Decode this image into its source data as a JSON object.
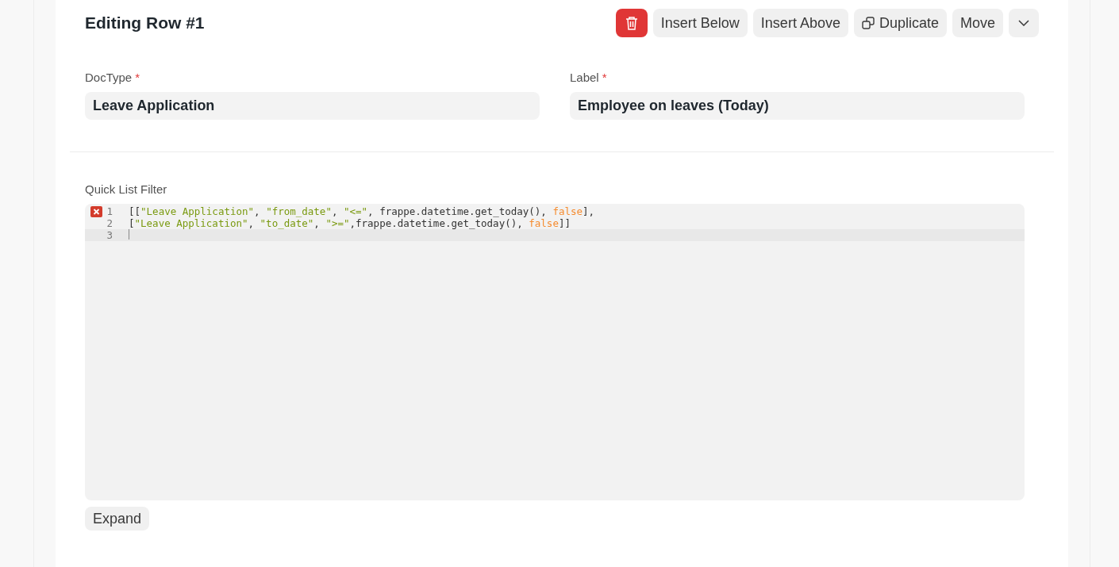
{
  "header": {
    "title": "Editing Row #1"
  },
  "actions": [
    {
      "kind": "delete"
    },
    {
      "kind": "text",
      "label": "Insert Below"
    },
    {
      "kind": "text",
      "label": "Insert Above"
    },
    {
      "kind": "duplicate",
      "label": "Duplicate"
    },
    {
      "kind": "text",
      "label": "Move"
    },
    {
      "kind": "more"
    }
  ],
  "fields": [
    {
      "label": "DocType",
      "required_mark": "*",
      "value": "Leave Application"
    },
    {
      "label": "Label",
      "required_mark": "*",
      "value": "Employee on leaves (Today)"
    }
  ],
  "code_field": {
    "label": "Quick List Filter",
    "lines": [
      {
        "number": "1",
        "error": true,
        "active": false,
        "tokens": [
          {
            "kind": "plain",
            "text": "[["
          },
          {
            "kind": "string",
            "text": "\"Leave Application\""
          },
          {
            "kind": "plain",
            "text": ", "
          },
          {
            "kind": "string",
            "text": "\"from_date\""
          },
          {
            "kind": "plain",
            "text": ", "
          },
          {
            "kind": "string",
            "text": "\"<=\""
          },
          {
            "kind": "plain",
            "text": ", frappe.datetime.get_today(), "
          },
          {
            "kind": "keyword",
            "text": "false"
          },
          {
            "kind": "plain",
            "text": "],"
          }
        ]
      },
      {
        "number": "2",
        "error": false,
        "active": false,
        "tokens": [
          {
            "kind": "plain",
            "text": "["
          },
          {
            "kind": "string",
            "text": "\"Leave Application\""
          },
          {
            "kind": "plain",
            "text": ", "
          },
          {
            "kind": "string",
            "text": "\"to_date\""
          },
          {
            "kind": "plain",
            "text": ", "
          },
          {
            "kind": "string",
            "text": "\">=\""
          },
          {
            "kind": "plain",
            "text": ",frappe.datetime.get_today(), "
          },
          {
            "kind": "keyword",
            "text": "false"
          },
          {
            "kind": "plain",
            "text": "]]"
          }
        ]
      },
      {
        "number": "3",
        "error": false,
        "active": true
      }
    ],
    "expand_button": "Expand"
  }
}
